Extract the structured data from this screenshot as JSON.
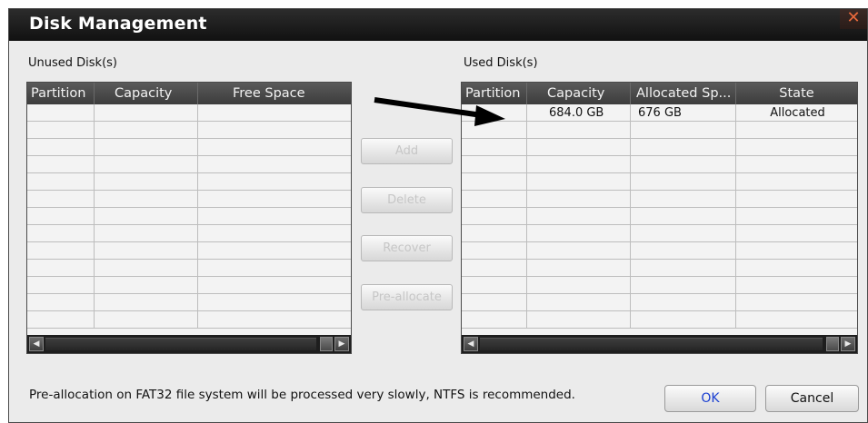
{
  "window": {
    "title": "Disk Management",
    "close_glyph": "✕"
  },
  "unused": {
    "label": "Unused Disk(s)",
    "columns": [
      "Partition",
      "Capacity",
      "Free Space"
    ],
    "rows": []
  },
  "used": {
    "label": "Used Disk(s)",
    "columns": [
      "Partition",
      "Capacity",
      "Allocated Sp...",
      "State"
    ],
    "rows": [
      {
        "partition": "",
        "capacity": "684.0 GB",
        "allocated": "676 GB",
        "state": "Allocated"
      }
    ]
  },
  "actions": {
    "add": "Add",
    "delete": "Delete",
    "recover": "Recover",
    "preallocate": "Pre-allocate"
  },
  "footer": {
    "note": "Pre-allocation on FAT32 file system will be processed very slowly, NTFS is recommended.",
    "ok": "OK",
    "cancel": "Cancel"
  },
  "colors": {
    "ok_text": "#1a3fd1",
    "title_text": "#ffffff",
    "close_glyph": "#e8693b",
    "header_bg": "#484848"
  },
  "icons": {
    "scroll_left": "◀",
    "scroll_right": "▶",
    "annotation": "arrow-annotation"
  }
}
